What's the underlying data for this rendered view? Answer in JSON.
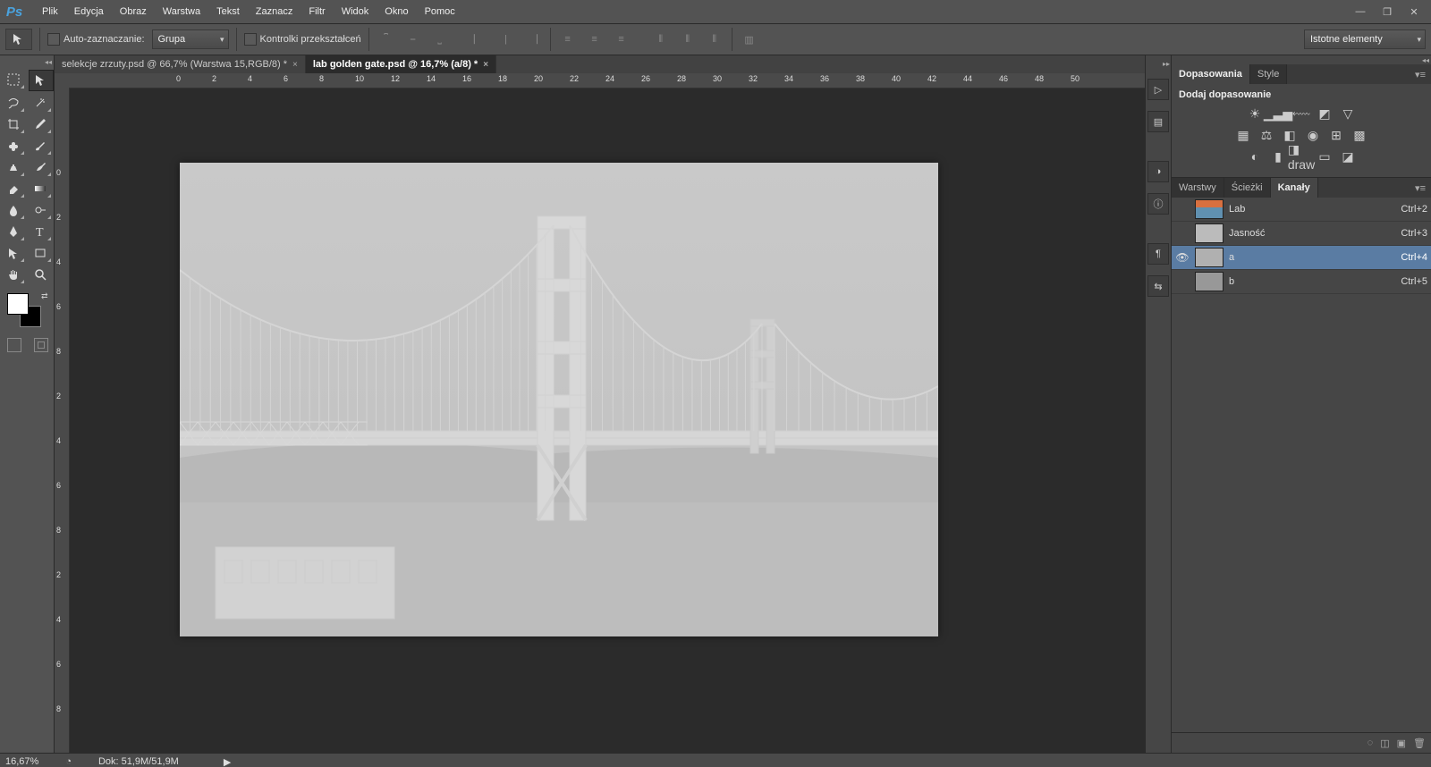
{
  "menu": {
    "items": [
      "Plik",
      "Edycja",
      "Obraz",
      "Warstwa",
      "Tekst",
      "Zaznacz",
      "Filtr",
      "Widok",
      "Okno",
      "Pomoc"
    ]
  },
  "options": {
    "auto_select_label": "Auto-zaznaczanie:",
    "group": "Grupa",
    "transform_label": "Kontrolki przekształceń",
    "essentials": "Istotne elementy"
  },
  "tabs": [
    {
      "label": "selekcje zrzuty.psd @ 66,7% (Warstwa 15,RGB/8) *",
      "active": false
    },
    {
      "label": "lab golden gate.psd @ 16,7% (a/8) *",
      "active": true
    }
  ],
  "ruler_h": [
    "0",
    "2",
    "4",
    "6",
    "8",
    "10",
    "12",
    "14",
    "16",
    "18",
    "20",
    "22",
    "24",
    "26",
    "28",
    "30",
    "32",
    "34",
    "36",
    "38",
    "40",
    "42",
    "44",
    "46",
    "48",
    "50"
  ],
  "ruler_v": [
    "0",
    "2",
    "4",
    "6",
    "8",
    "2",
    "4",
    "6",
    "8",
    "2",
    "4",
    "6",
    "8"
  ],
  "adjustments": {
    "tabs": [
      "Dopasowania",
      "Style"
    ],
    "title": "Dodaj dopasowanie"
  },
  "channels_panel": {
    "tabs": [
      "Warstwy",
      "Ścieżki",
      "Kanały"
    ],
    "rows": [
      {
        "name": "Lab",
        "shortcut": "Ctrl+2",
        "vis": false,
        "thumb": "color"
      },
      {
        "name": "Jasność",
        "shortcut": "Ctrl+3",
        "vis": false,
        "thumb": "light"
      },
      {
        "name": "a",
        "shortcut": "Ctrl+4",
        "vis": true,
        "thumb": "a",
        "sel": true
      },
      {
        "name": "b",
        "shortcut": "Ctrl+5",
        "vis": false,
        "thumb": "b"
      }
    ]
  },
  "status": {
    "zoom": "16,67%",
    "doc": "Dok: 51,9M/51,9M"
  }
}
